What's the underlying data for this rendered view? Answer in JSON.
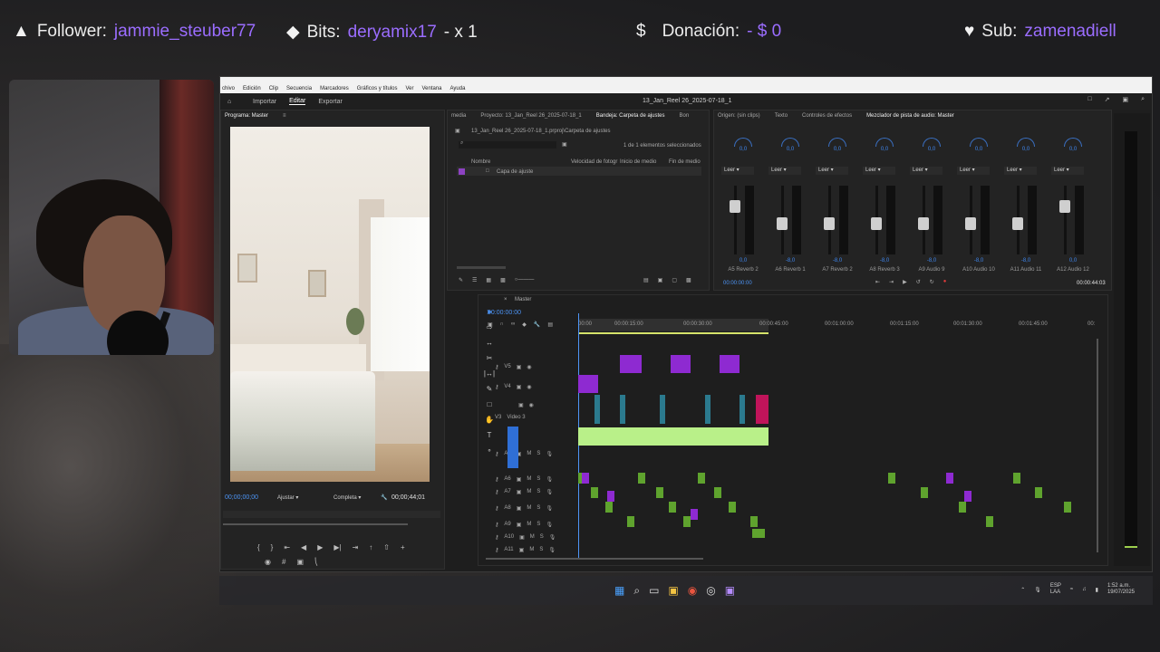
{
  "overlay": {
    "follower_label": "Follower:",
    "follower_name": "jammie_steuber77",
    "bits_label": "Bits:",
    "bits_name": "deryamix17",
    "bits_count": "- x 1",
    "donation_label": "Donación:",
    "donation_amount": "- $ 0",
    "sub_label": "Sub:",
    "sub_name": "zamenadiell"
  },
  "menubar": [
    "chivo",
    "Edición",
    "Clip",
    "Secuencia",
    "Marcadores",
    "Gráficos y títulos",
    "Ver",
    "Ventana",
    "Ayuda"
  ],
  "header": {
    "tabs": [
      "Importar",
      "Editar",
      "Exportar"
    ],
    "active_tab": "Editar",
    "project_title": "13_Jan_Reel 26_2025-07-18_1"
  },
  "program_monitor": {
    "title": "Programa: Master",
    "timecode_current": "00;00;00;00",
    "fit_label": "Ajustar",
    "quality_label": "Completa",
    "timecode_end": "00;00;44;01"
  },
  "project_panel": {
    "tabs": [
      "media",
      "Proyecto: 13_Jan_Reel 26_2025-07-18_1",
      "Bandeja: Carpeta de ajustes",
      "Bon"
    ],
    "path": "13_Jan_Reel 26_2025-07-18_1.prproj\\Carpeta de ajustes",
    "selection_info": "1 de 1 elementos seleccionados",
    "columns": [
      "Nombre",
      "Velocidad de fotogr",
      "Inicio de medio",
      "Fin de medio"
    ],
    "items": [
      {
        "name": "Capa de ajuste"
      }
    ]
  },
  "mixer": {
    "tabs": [
      "Origen: (sin clips)",
      "Texto",
      "Controles de efectos",
      "Mezclador de pista de audio: Master"
    ],
    "pan_value": "0,0",
    "read_label": "Leer",
    "channels": [
      {
        "name": "A5",
        "sub": "Reverb 2",
        "value": "0,0",
        "fader": 0.7
      },
      {
        "name": "A6",
        "sub": "Reverb 1",
        "value": "-8,0",
        "fader": 0.45
      },
      {
        "name": "A7",
        "sub": "Reverb 2",
        "value": "-8,0",
        "fader": 0.45
      },
      {
        "name": "A8",
        "sub": "Reverb 3",
        "value": "-8,0",
        "fader": 0.45
      },
      {
        "name": "A9",
        "sub": "Audio 9",
        "value": "-8,0",
        "fader": 0.45
      },
      {
        "name": "A10",
        "sub": "Audio 10",
        "value": "-8,0",
        "fader": 0.45
      },
      {
        "name": "A11",
        "sub": "Audio 11",
        "value": "-8,0",
        "fader": 0.45
      },
      {
        "name": "A12",
        "sub": "Audio 12",
        "value": "0,0",
        "fader": 0.7
      }
    ],
    "timecode_current": "00:00:00:00",
    "timecode_end": "00:00:44:03"
  },
  "timeline": {
    "sequence_name": "Master",
    "timecode": "00:00:00:00",
    "ruler": [
      "00:00",
      "00:00:15:00",
      "00:00:30:00",
      "00:00:45:00",
      "00:01:00:00",
      "00:01:15:00",
      "00:01:30:00",
      "00:01:45:00",
      "00:"
    ],
    "video_tracks": [
      "V5",
      "V4",
      "V3"
    ],
    "video3_name": "Video 3",
    "audio_tracks": [
      "A4",
      "A5",
      "A6",
      "A7",
      "A8",
      "A9",
      "A10",
      "A11"
    ]
  },
  "taskbar": {
    "lang_top": "ESP",
    "lang_bottom": "LAA",
    "time": "1:52 a.m.",
    "date": "19/07/2025"
  }
}
